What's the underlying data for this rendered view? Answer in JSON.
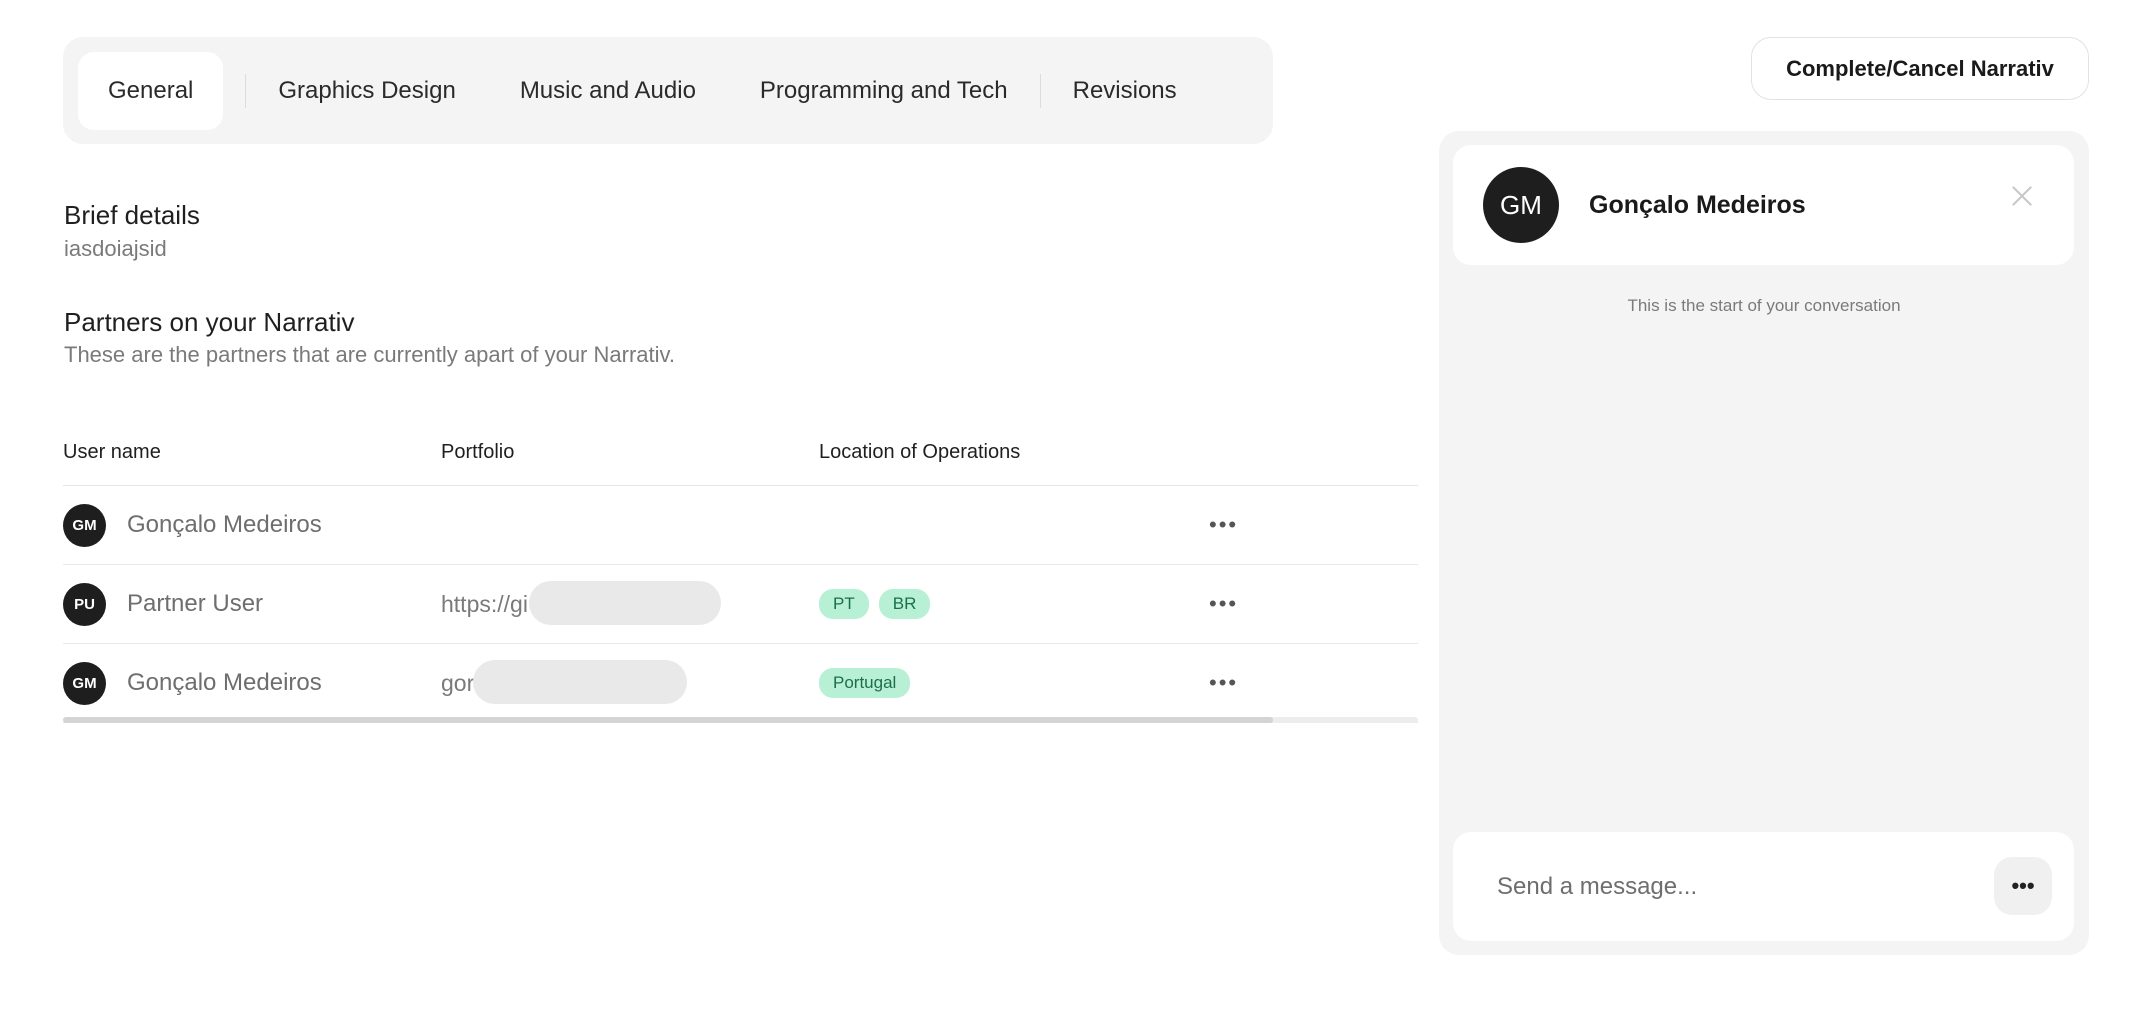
{
  "tabs": [
    {
      "label": "General",
      "active": true
    },
    {
      "label": "Graphics Design",
      "active": false
    },
    {
      "label": "Music and Audio",
      "active": false
    },
    {
      "label": "Programming and Tech",
      "active": false
    },
    {
      "label": "Revisions",
      "active": false
    }
  ],
  "brief": {
    "title": "Brief details",
    "value": "iasdoiajsid"
  },
  "partners": {
    "title": "Partners on your Narrativ",
    "subtitle": "These are the partners that are currently apart of your Narrativ."
  },
  "table": {
    "headers": [
      "User name",
      "Portfolio",
      "Location of Operations"
    ],
    "rows": [
      {
        "initials": "GM",
        "name": "Gonçalo Medeiros",
        "portfolio": "",
        "locations": [],
        "more": "•••"
      },
      {
        "initials": "PU",
        "name": "Partner User",
        "portfolio": "https://gi",
        "locations": [
          "PT",
          "BR"
        ],
        "more": "•••"
      },
      {
        "initials": "GM",
        "name": "Gonçalo Medeiros",
        "portfolio": "gor",
        "locations": [
          "Portugal"
        ],
        "more": "•••"
      }
    ]
  },
  "actions": {
    "complete_cancel_label": "Complete/Cancel Narrativ"
  },
  "chat": {
    "initials": "GM",
    "name": "Gonçalo Medeiros",
    "start_text": "This is the start of your conversation",
    "input_placeholder": "Send a message...",
    "more_label": "•••"
  },
  "colors": {
    "chip_bg": "#b8f0d5",
    "chip_text": "#1b6f49",
    "avatar_bg": "#1e1e1e",
    "panel_bg": "#f4f4f4"
  }
}
